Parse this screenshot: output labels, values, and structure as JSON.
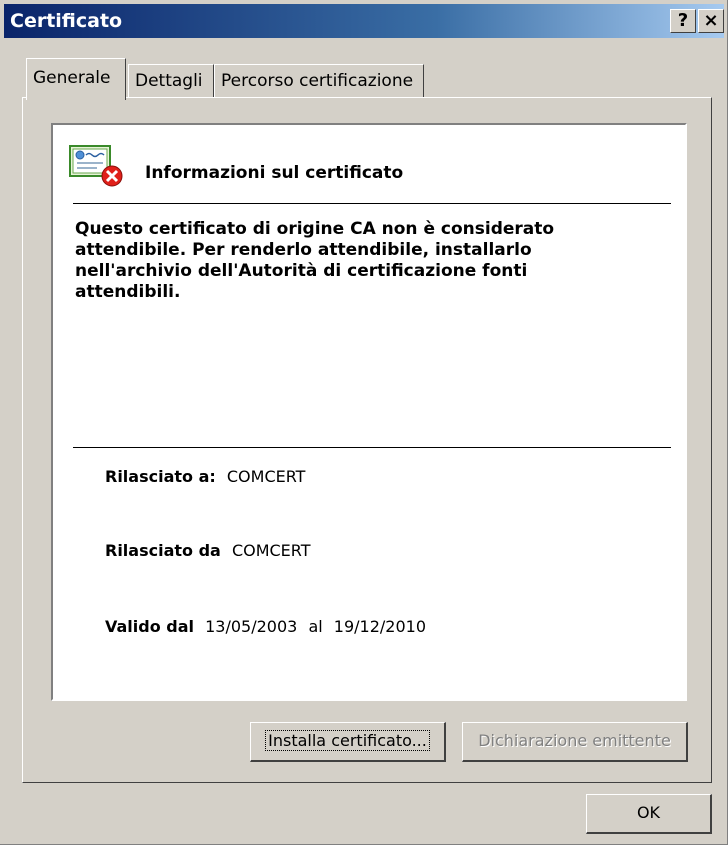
{
  "window": {
    "title": "Certificato",
    "help_label": "?",
    "close_label": "×"
  },
  "tabs": [
    {
      "label": "Generale",
      "active": true
    },
    {
      "label": "Dettagli",
      "active": false
    },
    {
      "label": "Percorso certificazione",
      "active": false
    }
  ],
  "info": {
    "header": "Informazioni sul certificato",
    "icon": "certificate-error-icon",
    "warning": "Questo certificato di origine CA non è considerato attendibile. Per renderlo attendibile, installarlo nell'archivio dell'Autorità di certificazione fonti attendibili.",
    "issued_to_label": "Rilasciato a:",
    "issued_to_value": "COMCERT",
    "issued_by_label": "Rilasciato da",
    "issued_by_value": "COMCERT",
    "valid_from_label": "Valido dal",
    "valid_from_value": "13/05/2003",
    "valid_to_label": "al",
    "valid_to_value": "19/12/2010"
  },
  "buttons": {
    "install": "Installa certificato...",
    "issuer_statement": "Dichiarazione emittente",
    "ok": "OK"
  },
  "colors": {
    "titlebar_start": "#0a246a",
    "titlebar_end": "#a6caf0",
    "dialog_face": "#d4d0c8",
    "error_red": "#e0201a"
  }
}
